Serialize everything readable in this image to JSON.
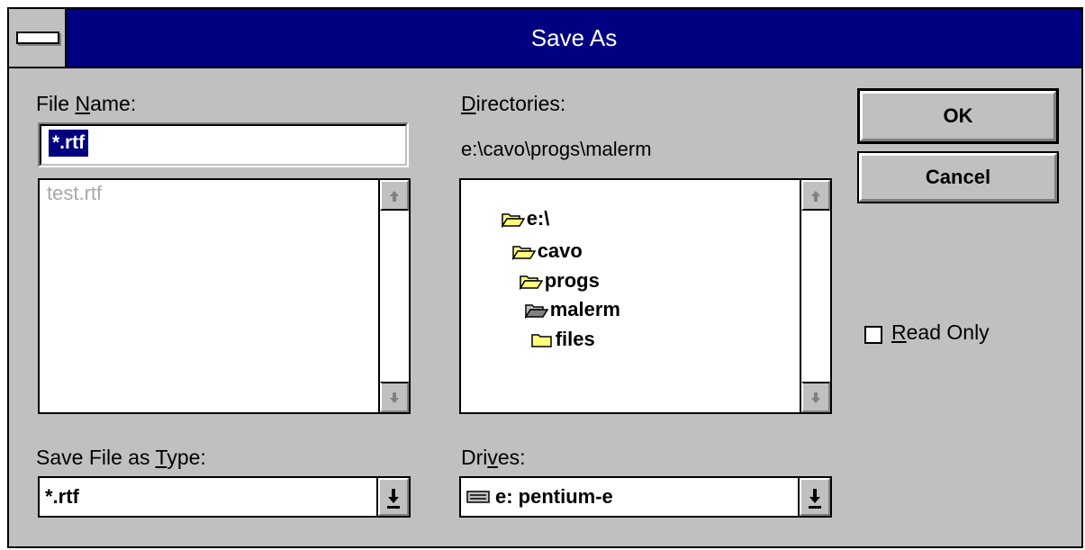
{
  "window": {
    "title": "Save As"
  },
  "file_name": {
    "label": "File Name:",
    "value": "*.rtf",
    "files": [
      "test.rtf"
    ]
  },
  "directories": {
    "label": "Directories:",
    "current_path": "e:\\cavo\\progs\\malerm",
    "tree": [
      {
        "name": "e:\\",
        "icon": "open-folder-icon"
      },
      {
        "name": "cavo",
        "icon": "open-folder-icon"
      },
      {
        "name": "progs",
        "icon": "open-folder-icon"
      },
      {
        "name": "malerm",
        "icon": "open-folder-selected-icon"
      },
      {
        "name": "files",
        "icon": "closed-folder-icon"
      }
    ]
  },
  "save_type": {
    "label": "Save File as Type:",
    "value": "*.rtf"
  },
  "drives": {
    "label": "Drives:",
    "value": "e: pentium-e",
    "icon": "drive-icon"
  },
  "buttons": {
    "ok": "OK",
    "cancel": "Cancel"
  },
  "read_only": {
    "label": "Read Only",
    "checked": false
  },
  "colors": {
    "titlebar": "#000080",
    "face": "#c0c0c0",
    "folder": "#ffff80"
  }
}
